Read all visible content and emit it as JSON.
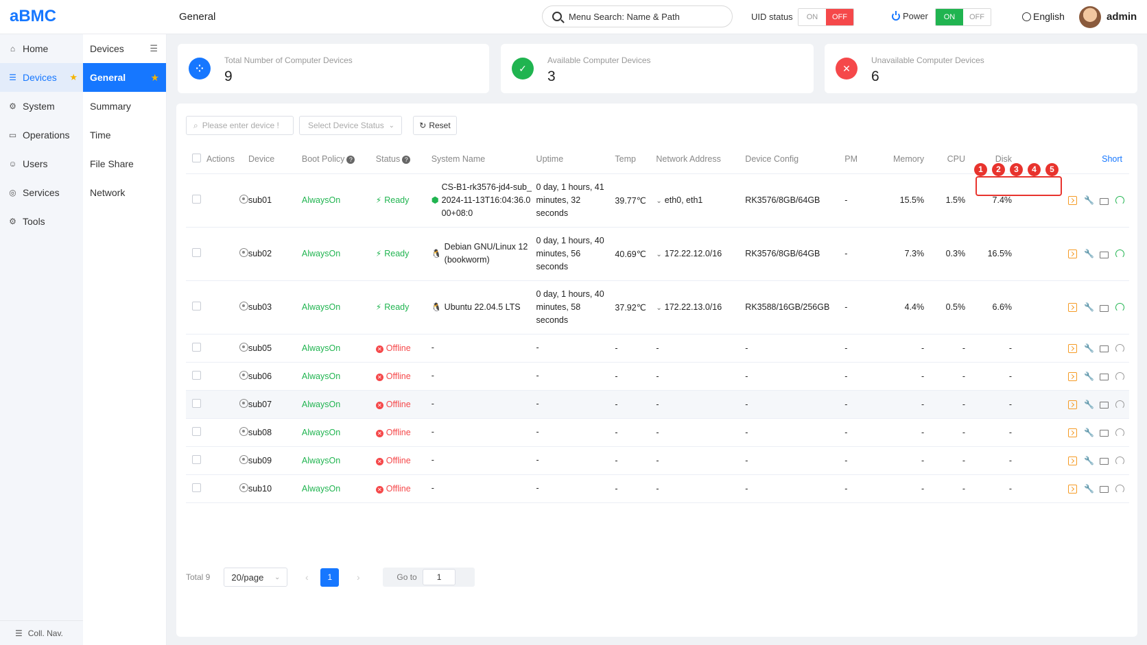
{
  "app": {
    "logo": "aBMC",
    "page_title": "General"
  },
  "header": {
    "search_placeholder": "Menu Search: Name & Path",
    "uid_label": "UID status",
    "uid_on": "ON",
    "uid_off": "OFF",
    "power_label": "Power",
    "power_on": "ON",
    "power_off": "OFF",
    "language": "English",
    "user": "admin"
  },
  "sidebar": {
    "items": [
      {
        "label": "Home",
        "icon": "home-icon"
      },
      {
        "label": "Devices",
        "icon": "list-icon",
        "active": true
      },
      {
        "label": "System",
        "icon": "gear-icon"
      },
      {
        "label": "Operations",
        "icon": "monitor-icon"
      },
      {
        "label": "Users",
        "icon": "users-icon"
      },
      {
        "label": "Services",
        "icon": "services-icon"
      },
      {
        "label": "Tools",
        "icon": "tools-icon"
      }
    ],
    "collapse_label": "Coll. Nav."
  },
  "subnav": {
    "heading": "Devices",
    "items": [
      "General",
      "Summary",
      "Time",
      "File Share",
      "Network"
    ]
  },
  "stats": [
    {
      "label": "Total Number of Computer Devices",
      "value": "9",
      "color": "#1677ff"
    },
    {
      "label": "Available Computer Devices",
      "value": "3",
      "color": "#20b450"
    },
    {
      "label": "Unavailable Computer Devices",
      "value": "6",
      "color": "#f5484a"
    }
  ],
  "filters": {
    "device_placeholder": "Please enter device !",
    "status_placeholder": "Select Device Status",
    "reset_label": "Reset"
  },
  "table": {
    "headers": {
      "actions": "Actions",
      "device": "Device",
      "boot_policy": "Boot Policy",
      "status": "Status",
      "system_name": "System Name",
      "uptime": "Uptime",
      "temp": "Temp",
      "network": "Network Address",
      "config": "Device Config",
      "pm": "PM",
      "memory": "Memory",
      "cpu": "CPU",
      "disk": "Disk",
      "short": "Short"
    },
    "rows": [
      {
        "device": "sub01",
        "boot": "AlwaysOn",
        "status": "Ready",
        "os": "android",
        "system": "CS-B1-rk3576-jd4-sub_2024-11-13T16:04:36.000+08:0",
        "uptime": "0 day, 1 hours, 41 minutes, 32 seconds",
        "temp": "39.77℃",
        "network": "eth0, eth1",
        "config": "RK3576/8GB/64GB",
        "pm": "-",
        "memory": "15.5%",
        "cpu": "1.5%",
        "disk": "7.4%"
      },
      {
        "device": "sub02",
        "boot": "AlwaysOn",
        "status": "Ready",
        "os": "linux",
        "system": "Debian GNU/Linux 12 (bookworm)",
        "uptime": "0 day, 1 hours, 40 minutes, 56 seconds",
        "temp": "40.69℃",
        "network": "172.22.12.0/16",
        "config": "RK3576/8GB/64GB",
        "pm": "-",
        "memory": "7.3%",
        "cpu": "0.3%",
        "disk": "16.5%"
      },
      {
        "device": "sub03",
        "boot": "AlwaysOn",
        "status": "Ready",
        "os": "linux",
        "system": "Ubuntu 22.04.5 LTS",
        "uptime": "0 day, 1 hours, 40 minutes, 58 seconds",
        "temp": "37.92℃",
        "network": "172.22.13.0/16",
        "config": "RK3588/16GB/256GB",
        "pm": "-",
        "memory": "4.4%",
        "cpu": "0.5%",
        "disk": "6.6%"
      },
      {
        "device": "sub05",
        "boot": "AlwaysOn",
        "status": "Offline",
        "os": "",
        "system": "-",
        "uptime": "-",
        "temp": "-",
        "network": "-",
        "config": "-",
        "pm": "-",
        "memory": "-",
        "cpu": "-",
        "disk": "-"
      },
      {
        "device": "sub06",
        "boot": "AlwaysOn",
        "status": "Offline",
        "os": "",
        "system": "-",
        "uptime": "-",
        "temp": "-",
        "network": "-",
        "config": "-",
        "pm": "-",
        "memory": "-",
        "cpu": "-",
        "disk": "-"
      },
      {
        "device": "sub07",
        "boot": "AlwaysOn",
        "status": "Offline",
        "os": "",
        "system": "-",
        "uptime": "-",
        "temp": "-",
        "network": "-",
        "config": "-",
        "pm": "-",
        "memory": "-",
        "cpu": "-",
        "disk": "-"
      },
      {
        "device": "sub08",
        "boot": "AlwaysOn",
        "status": "Offline",
        "os": "",
        "system": "-",
        "uptime": "-",
        "temp": "-",
        "network": "-",
        "config": "-",
        "pm": "-",
        "memory": "-",
        "cpu": "-",
        "disk": "-"
      },
      {
        "device": "sub09",
        "boot": "AlwaysOn",
        "status": "Offline",
        "os": "",
        "system": "-",
        "uptime": "-",
        "temp": "-",
        "network": "-",
        "config": "-",
        "pm": "-",
        "memory": "-",
        "cpu": "-",
        "disk": "-"
      },
      {
        "device": "sub10",
        "boot": "AlwaysOn",
        "status": "Offline",
        "os": "",
        "system": "-",
        "uptime": "-",
        "temp": "-",
        "network": "-",
        "config": "-",
        "pm": "-",
        "memory": "-",
        "cpu": "-",
        "disk": "-"
      }
    ]
  },
  "annotation_badges": [
    "1",
    "2",
    "3",
    "4",
    "5"
  ],
  "pagination": {
    "total": "Total 9",
    "per_page": "20/page",
    "current_page": "1",
    "goto_label": "Go to",
    "goto_value": "1"
  }
}
